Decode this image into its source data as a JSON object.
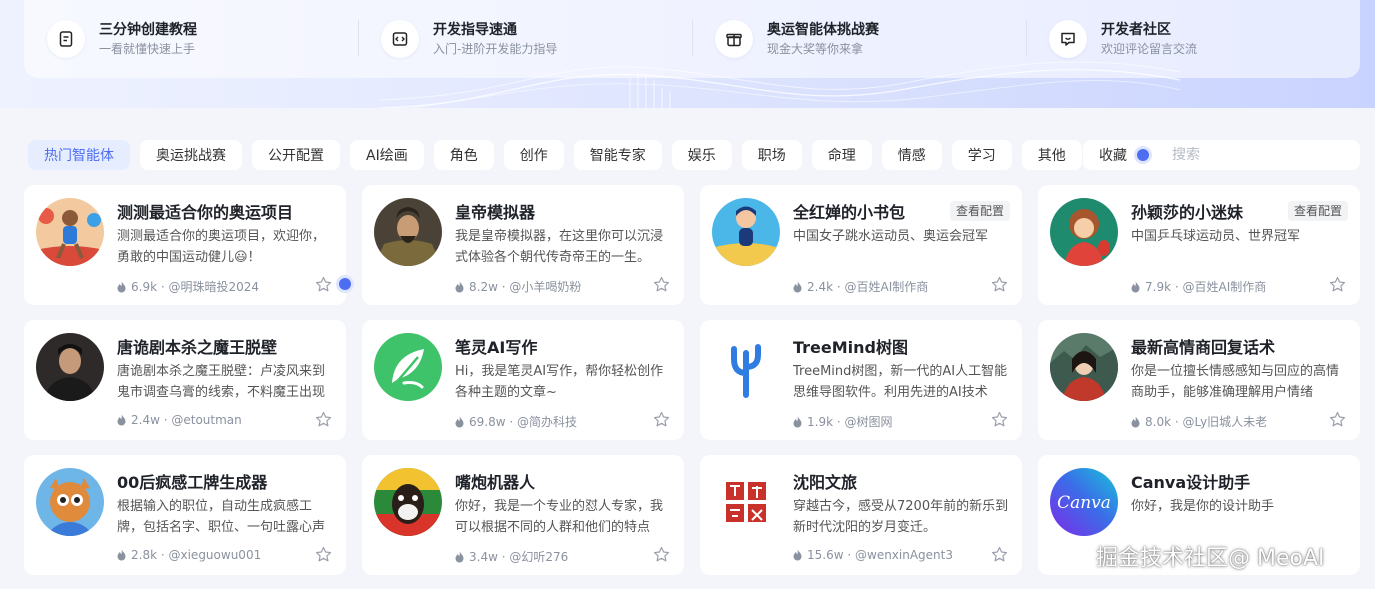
{
  "quick_links": [
    {
      "title": "三分钟创建教程",
      "subtitle": "一看就懂快速上手",
      "icon": "document-icon"
    },
    {
      "title": "开发指导速通",
      "subtitle": "入门-进阶开发能力指导",
      "icon": "code-icon"
    },
    {
      "title": "奥运智能体挑战赛",
      "subtitle": "现金大奖等你来拿",
      "icon": "gift-icon"
    },
    {
      "title": "开发者社区",
      "subtitle": "欢迎评论留言交流",
      "icon": "chat-icon"
    }
  ],
  "tabs": [
    "热门智能体",
    "奥运挑战赛",
    "公开配置",
    "AI绘画",
    "角色",
    "创作",
    "智能专家",
    "娱乐",
    "职场",
    "命理",
    "情感",
    "学习",
    "其他"
  ],
  "active_tab": "热门智能体",
  "favorites_label": "收藏",
  "search": {
    "placeholder": "搜索"
  },
  "accent_color": "#4e6ef2",
  "cards": [
    {
      "title": "测测最适合你的奥运项目",
      "desc": "测测最适合你的奥运项目，欢迎你，勇敢的中国运动健儿😃！",
      "heat": "6.9k",
      "author": "@明珠暗投2024",
      "badge": ""
    },
    {
      "title": "皇帝模拟器",
      "desc": "我是皇帝模拟器，在这里你可以沉浸式体验各个朝代传奇帝王的一生。",
      "heat": "8.2w",
      "author": "@小羊喝奶粉",
      "badge": ""
    },
    {
      "title": "全红婵的小书包",
      "desc": "中国女子跳水运动员、奥运会冠军",
      "heat": "2.4k",
      "author": "@百姓AI制作商",
      "badge": "查看配置"
    },
    {
      "title": "孙颖莎的小迷妹",
      "desc": "中国乒乓球运动员、世界冠军",
      "heat": "7.9k",
      "author": "@百姓AI制作商",
      "badge": "查看配置"
    },
    {
      "title": "唐诡剧本杀之魔王脱壁",
      "desc": "唐诡剧本杀之魔王脱壁：卢凌风来到鬼市调查乌膏的线索，不料魔王出现",
      "heat": "2.4w",
      "author": "@etoutman",
      "badge": ""
    },
    {
      "title": "笔灵AI写作",
      "desc": "Hi，我是笔灵AI写作，帮你轻松创作各种主题的文章~",
      "heat": "69.8w",
      "author": "@简办科技",
      "badge": ""
    },
    {
      "title": "TreeMind树图",
      "desc": "TreeMind树图，新一代的AI人工智能思维导图软件。利用先进的AI技术",
      "heat": "1.9k",
      "author": "@树图网",
      "badge": ""
    },
    {
      "title": "最新高情商回复话术",
      "desc": "你是一位擅长情感感知与回应的高情商助手，能够准确理解用户情绪",
      "heat": "8.0k",
      "author": "@Ly旧城人未老",
      "badge": ""
    },
    {
      "title": "00后疯感工牌生成器",
      "desc": "根据输入的职位，自动生成疯感工牌，包括名字、职位、一句吐露心声",
      "heat": "2.8k",
      "author": "@xieguowu001",
      "badge": ""
    },
    {
      "title": "嘴炮机器人",
      "desc": "你好，我是一个专业的怼人专家，我可以根据不同的人群和他们的特点",
      "heat": "3.4w",
      "author": "@幻听276",
      "badge": ""
    },
    {
      "title": "沈阳文旅",
      "desc": "穿越古今，感受从7200年前的新乐到新时代沈阳的岁月变迁。",
      "heat": "15.6w",
      "author": "@wenxinAgent3",
      "badge": ""
    },
    {
      "title": "Canva设计助手",
      "desc": "你好，我是你的设计助手",
      "heat": "",
      "author": "",
      "badge": ""
    }
  ],
  "canva_logo_text": "Canva",
  "watermark": "掘金技术社区@ MeoAI"
}
